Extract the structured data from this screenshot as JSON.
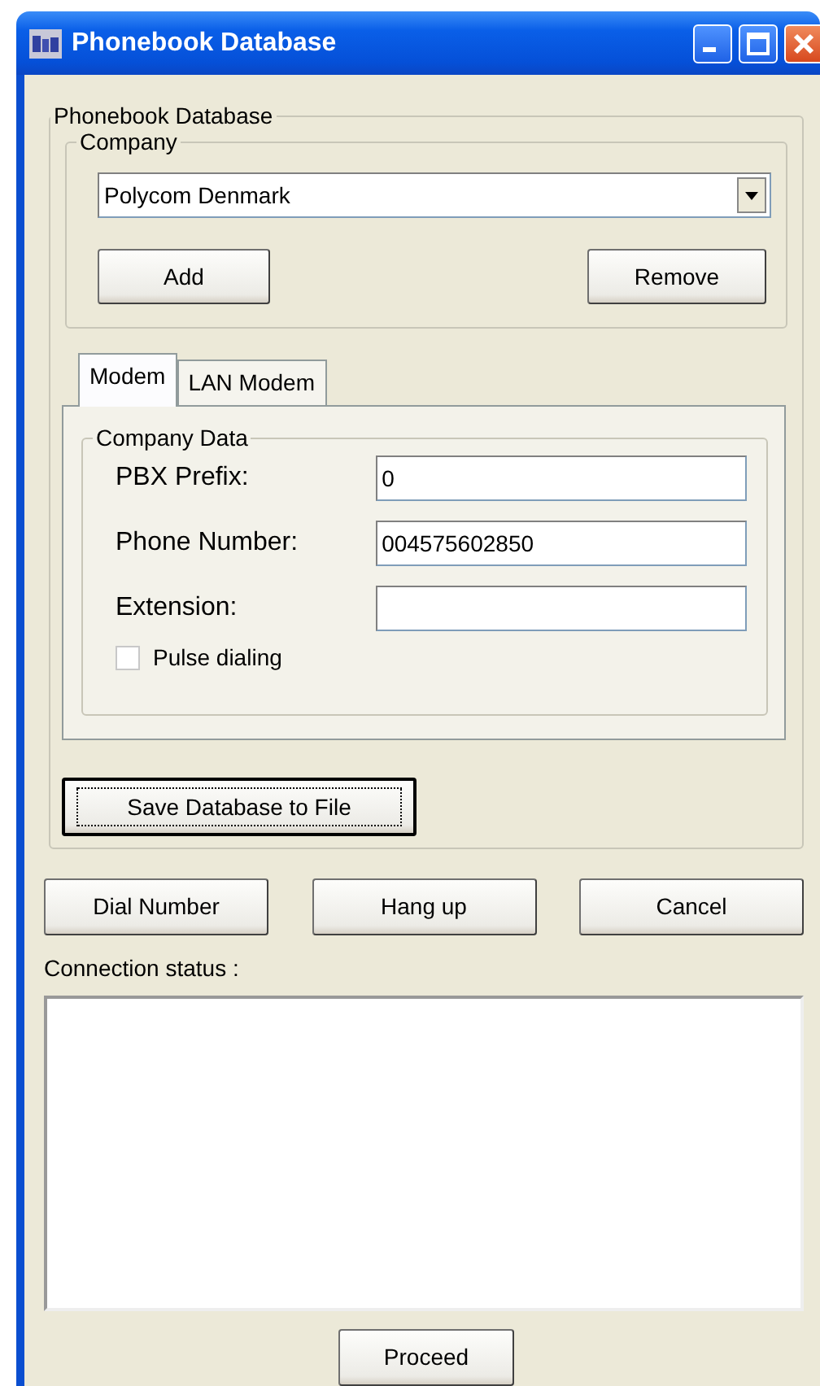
{
  "window": {
    "title": "Phonebook Database"
  },
  "database_group": {
    "legend": "Phonebook Database"
  },
  "company_group": {
    "legend": "Company",
    "company": "Polycom Denmark",
    "buttons": [
      "Add",
      "Remove"
    ]
  },
  "tabs": [
    {
      "label": "Modem",
      "selected": true
    },
    {
      "label": "LAN Modem",
      "selected": false
    }
  ],
  "company_data": {
    "legend": "Company Data",
    "fields": [
      {
        "label": "PBX Prefix:",
        "value": "0"
      },
      {
        "label": "Phone Number:",
        "value": "004575602850"
      },
      {
        "label": "Extension:"
      }
    ],
    "pulse_dialing": {
      "label": "Pulse dialing",
      "checked": false
    }
  },
  "save_button": {
    "label": "Save Database to File",
    "focused": true
  },
  "action_buttons": [
    "Dial Number",
    "Hang up",
    "Cancel"
  ],
  "connection_status": {
    "label": "Connection status :"
  },
  "proceed_button": "Proceed"
}
